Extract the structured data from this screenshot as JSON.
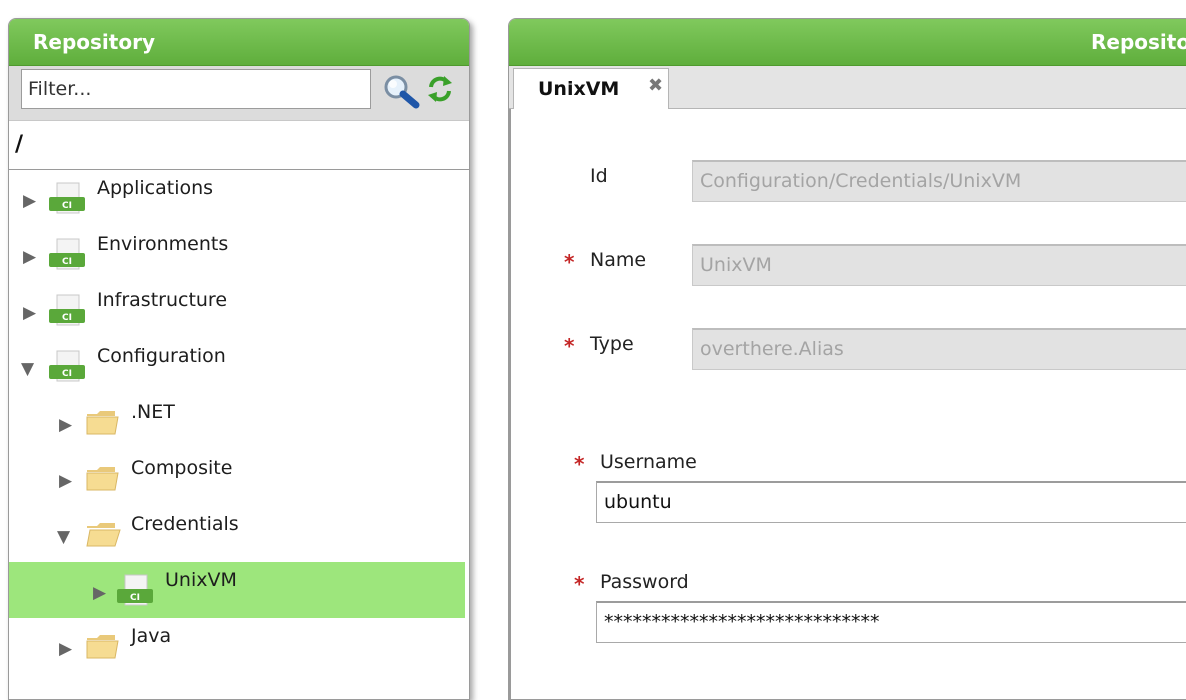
{
  "left_panel": {
    "title": "Repository",
    "filter_placeholder": "Filter...",
    "path": "/",
    "tree": [
      {
        "label": "Applications",
        "expanded": false,
        "icon": "ci-file-icon"
      },
      {
        "label": "Environments",
        "expanded": false,
        "icon": "ci-file-icon"
      },
      {
        "label": "Infrastructure",
        "expanded": false,
        "icon": "ci-file-icon"
      },
      {
        "label": "Configuration",
        "expanded": true,
        "icon": "ci-file-icon"
      },
      {
        "label": ".NET",
        "expanded": false,
        "icon": "folder-icon"
      },
      {
        "label": "Composite",
        "expanded": false,
        "icon": "folder-icon"
      },
      {
        "label": "Credentials",
        "expanded": true,
        "icon": "folder-icon"
      },
      {
        "label": "UnixVM",
        "expanded": false,
        "icon": "ci-file-icon",
        "selected": true
      },
      {
        "label": "Java",
        "expanded": false,
        "icon": "folder-icon"
      }
    ]
  },
  "right_panel": {
    "title": "Reposito",
    "tab_label": "UnixVM",
    "close_glyph": "✖",
    "required_mark": "*",
    "fields": {
      "id": {
        "label": "Id",
        "value": "Configuration/Credentials/UnixVM"
      },
      "name": {
        "label": "Name",
        "value": "UnixVM"
      },
      "type": {
        "label": "Type",
        "value": "overthere.Alias"
      },
      "username": {
        "label": "Username",
        "value": "ubuntu"
      },
      "password": {
        "label": "Password",
        "value": "*****************************"
      }
    }
  },
  "colors": {
    "header_green": "#6bbb47",
    "selected_row": "#9de67c",
    "required_star": "#c42626"
  }
}
